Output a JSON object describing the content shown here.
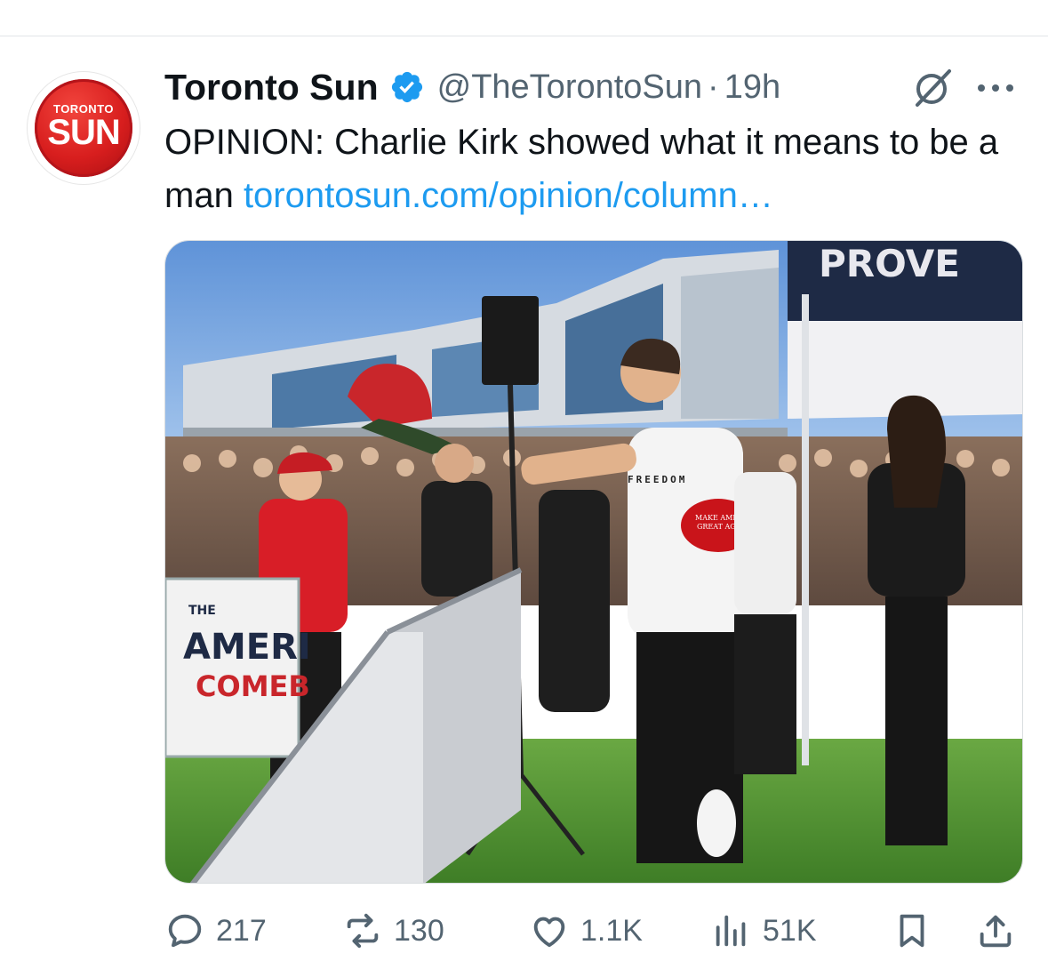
{
  "tweet": {
    "avatar": {
      "logo_top": "TORONTO",
      "logo_main": "SUN",
      "brand_color": "#d81e1e"
    },
    "author_name": "Toronto Sun",
    "verified_color": "#1d9bf0",
    "handle": "@TheTorontoSun",
    "separator": "·",
    "time": "19h",
    "text": "OPINION: Charlie Kirk showed what it means to be a man",
    "link": "torontosun.com/opinion/column…",
    "image": {
      "description_icon": "photo",
      "banner_text": "PROVE",
      "shirt_text": "FREEDOM",
      "hat_text_1": "MAKE AMERICA",
      "hat_text_2": "GREAT AGAIN",
      "fence_banner_1": "THE",
      "fence_banner_2": "AMERI",
      "fence_banner_3": "COMEB"
    },
    "metrics": {
      "replies": "217",
      "reposts": "130",
      "likes": "1.1K",
      "views": "51K"
    },
    "icons": {
      "reply": "reply-icon",
      "repost": "repost-icon",
      "like": "heart-icon",
      "views": "analytics-icon",
      "bookmark": "bookmark-icon",
      "share": "share-icon",
      "grok": "grok-icon",
      "more": "more-icon"
    },
    "colors": {
      "text": "#0f1419",
      "secondary": "#536471",
      "link": "#1d9bf0"
    }
  }
}
